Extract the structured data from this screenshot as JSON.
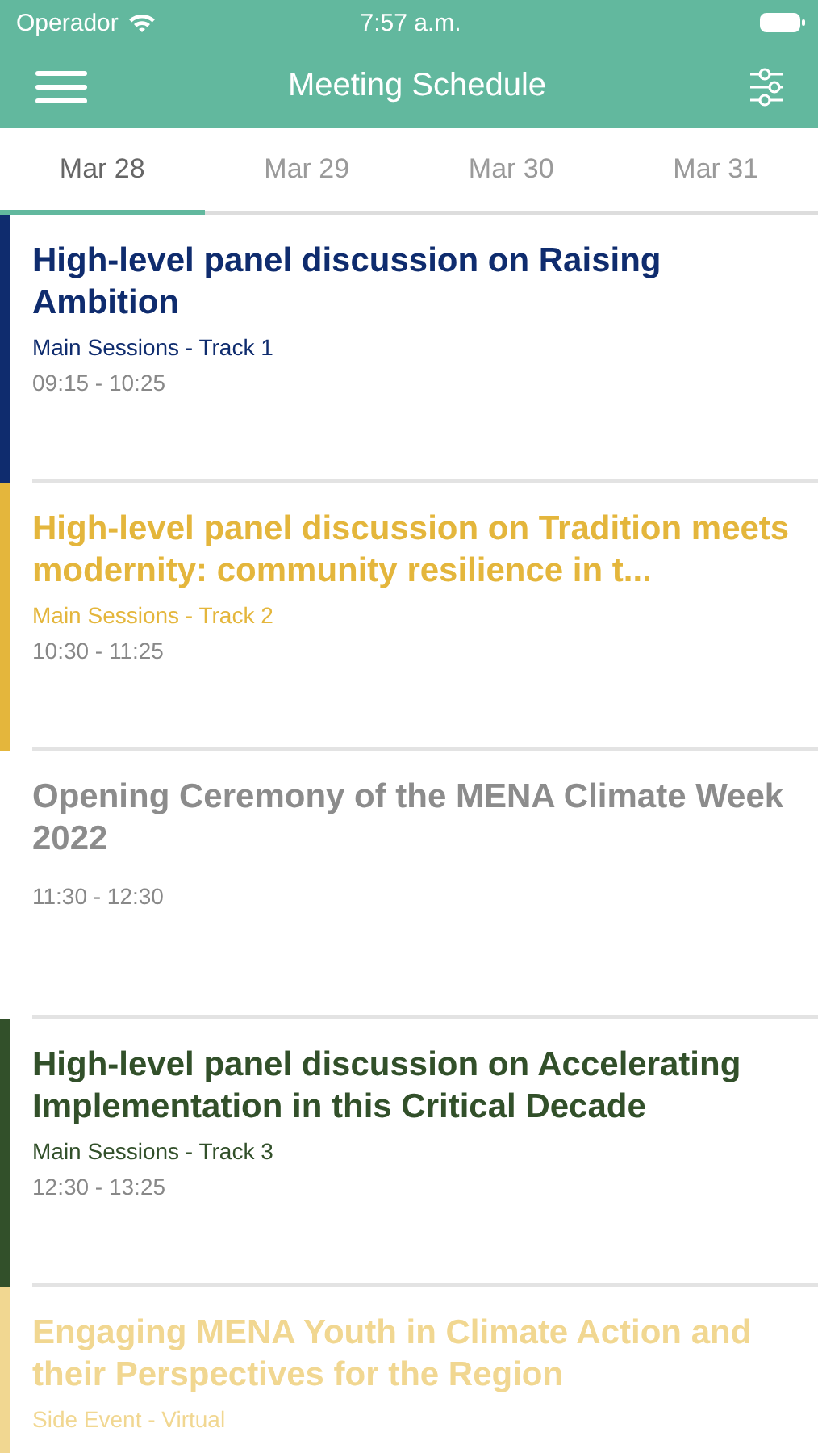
{
  "status_bar": {
    "carrier": "Operador",
    "time": "7:57 a.m."
  },
  "header": {
    "title": "Meeting Schedule"
  },
  "tabs": [
    {
      "label": "Mar 28",
      "selected": true
    },
    {
      "label": "Mar 29",
      "selected": false
    },
    {
      "label": "Mar 30",
      "selected": false
    },
    {
      "label": "Mar 31",
      "selected": false
    }
  ],
  "sessions": [
    {
      "title": "High-level panel discussion on Raising Ambition",
      "track": "Main Sessions - Track 1",
      "time": "09:15 - 10:25",
      "color": "#0f2c6e",
      "has_bar": true
    },
    {
      "title": "High-level panel discussion on Tradition meets modernity: community resilience in t...",
      "track": "Main Sessions - Track 2",
      "time": "10:30 - 11:25",
      "color": "#e4b63c",
      "has_bar": true
    },
    {
      "title": "Opening Ceremony of the MENA Climate Week 2022",
      "time": "11:30 - 12:30",
      "color": "#8c8c8c",
      "has_bar": false
    },
    {
      "title": "High-level panel discussion on Accelerating Implementation in this Critical Decade",
      "track": "Main Sessions - Track 3",
      "time": "12:30 - 13:25",
      "color": "#32502a",
      "has_bar": true
    },
    {
      "title": "Engaging MENA Youth in Climate Action and their Perspectives for the Region",
      "track": "Side Event - Virtual",
      "color": "#f1d791",
      "has_bar": true
    }
  ]
}
